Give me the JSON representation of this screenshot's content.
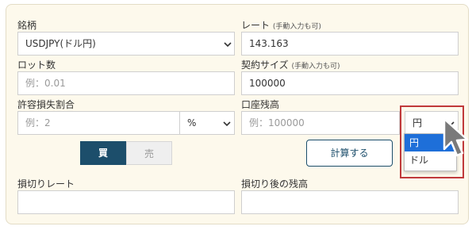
{
  "form": {
    "symbol_label": "銘柄",
    "symbol_value": "USDJPY(ドル円)",
    "rate_label": "レート",
    "rate_note": "(手動入力も可)",
    "rate_value": "143.163",
    "lot_label": "ロット数",
    "lot_placeholder": "例：0.01",
    "contract_label": "契約サイズ",
    "contract_note": "(手動入力も可)",
    "contract_value": "100000",
    "loss_ratio_label": "許容損失割合",
    "loss_ratio_placeholder": "例：2",
    "loss_unit_value": "%",
    "balance_label": "口座残高",
    "balance_placeholder": "例：100000",
    "currency_value": "円",
    "currency_options": [
      "円",
      "ドル"
    ],
    "buy_label": "買",
    "sell_label": "売",
    "calc_label": "計算する",
    "stop_rate_label": "損切りレート",
    "after_balance_label": "損切り後の残高"
  },
  "colors": {
    "panel_bg": "#fdf9ec",
    "accent": "#1c4e6b",
    "highlight": "#c0393b",
    "selected_option": "#1e6fd9"
  },
  "icons": {
    "select_arrow": "chevron-down-icon",
    "pointer": "mouse-pointer-icon"
  }
}
